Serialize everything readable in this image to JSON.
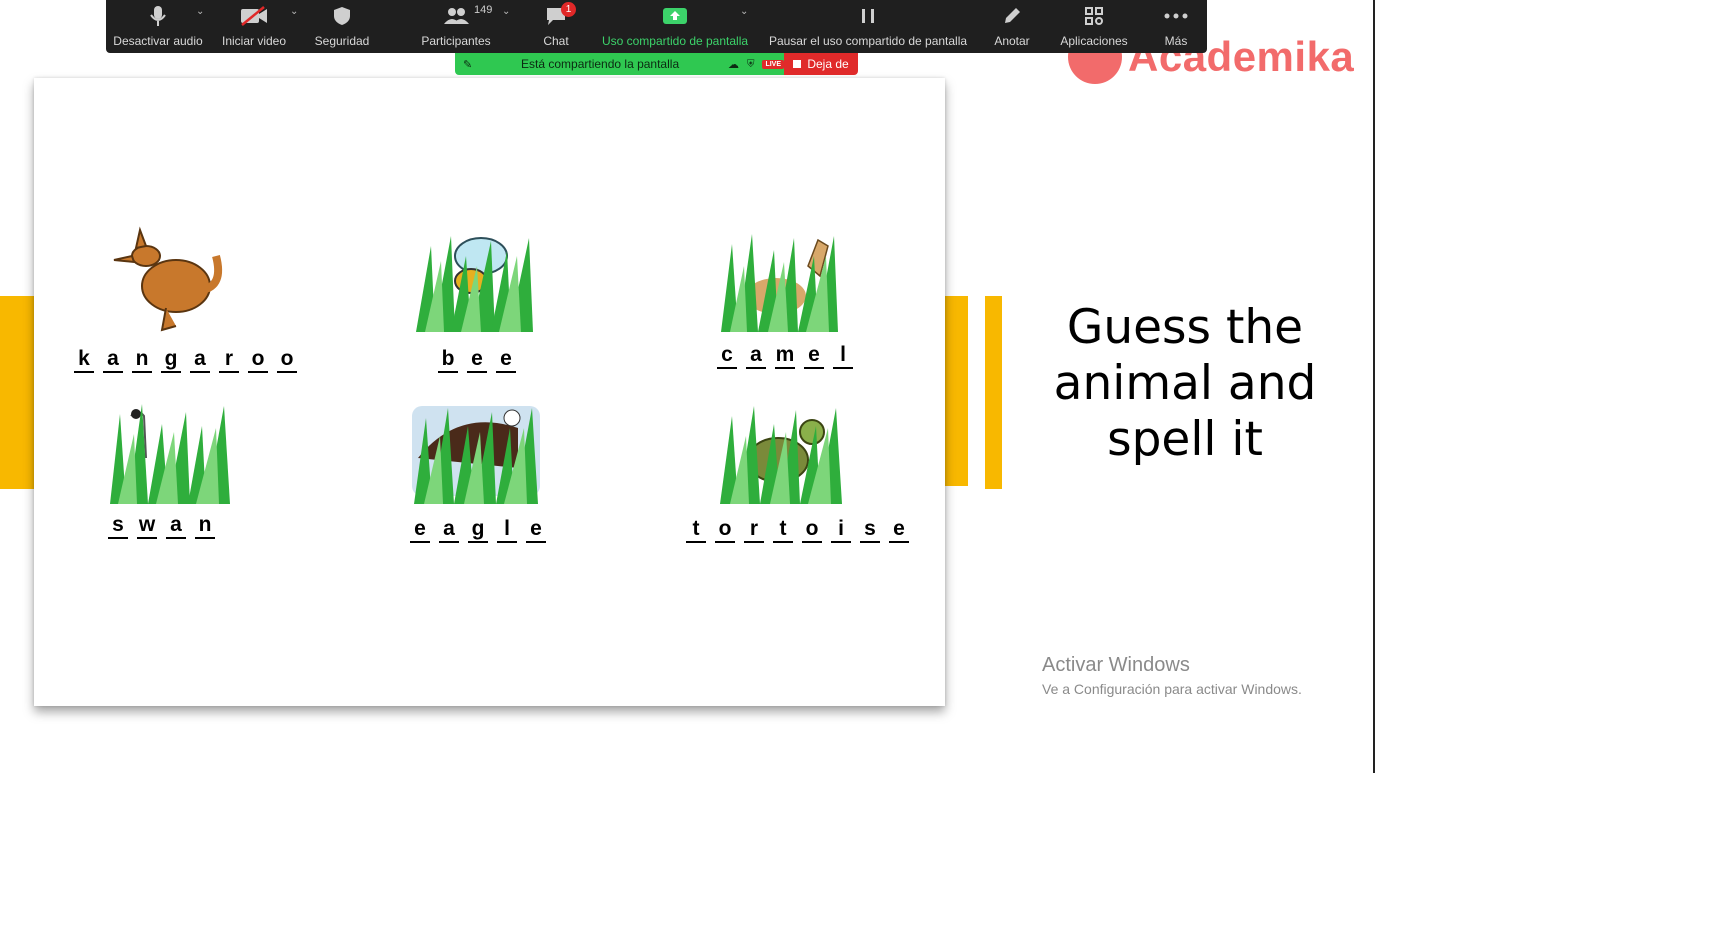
{
  "toolbar": {
    "mute_label": "Desactivar audio",
    "video_label": "Iniciar video",
    "security_label": "Seguridad",
    "participants_label": "Participantes",
    "participants_count": "149",
    "chat_label": "Chat",
    "chat_badge": "1",
    "share_label": "Uso compartido de pantalla",
    "pause_label": "Pausar el uso compartido de pantalla",
    "annotate_label": "Anotar",
    "apps_label": "Aplicaciones",
    "more_label": "Más",
    "accent_green": "#3cd26a"
  },
  "share_banner": {
    "status_text": "Está compartiendo la pantalla",
    "live_tag": "LIVE",
    "stop_label": "Deja de"
  },
  "brand": {
    "name": "Academika",
    "color": "#f26b6b"
  },
  "slide": {
    "heading": "Guess the animal and spell it",
    "animals": [
      {
        "name": "kangaroo",
        "letters": [
          "k",
          "a",
          "n",
          "g",
          "a",
          "r",
          "o",
          "o"
        ]
      },
      {
        "name": "bee",
        "letters": [
          "b",
          "e",
          "e"
        ]
      },
      {
        "name": "camel",
        "letters": [
          "c",
          "a",
          "m",
          "e",
          "l"
        ]
      },
      {
        "name": "swan",
        "letters": [
          "s",
          "w",
          "a",
          "n"
        ]
      },
      {
        "name": "eagle",
        "letters": [
          "e",
          "a",
          "g",
          "l",
          "e"
        ]
      },
      {
        "name": "tortoise",
        "letters": [
          "t",
          "o",
          "r",
          "t",
          "o",
          "i",
          "s",
          "e"
        ]
      }
    ]
  },
  "watermark": {
    "title": "Activar Windows",
    "subtitle": "Ve a Configuración para activar Windows."
  }
}
